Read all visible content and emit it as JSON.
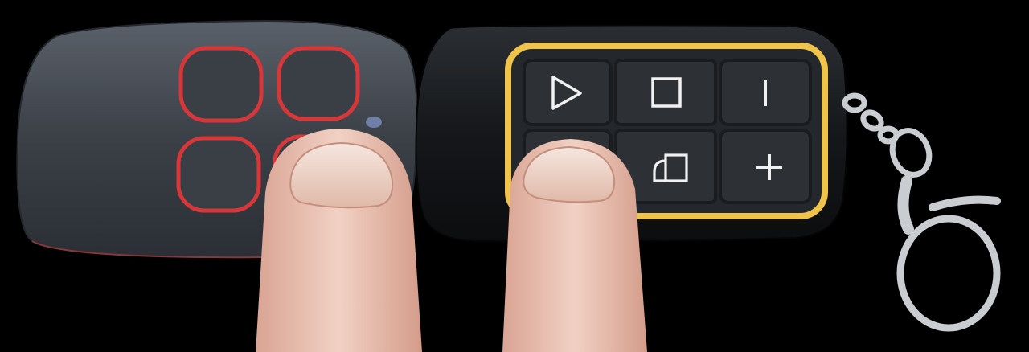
{
  "scene": {
    "background_color": "#000000",
    "left_remote": {
      "body_color": "#3c4148",
      "button_color": "#3a3f46",
      "button_ring_color": "#d8373a",
      "button_count": 4,
      "led_color": "#6f7fa8"
    },
    "right_remote": {
      "body_color": "#16181c",
      "panel_color": "#2a2d32",
      "panel_border_color": "#f0c34a",
      "keys": [
        {
          "icon": "play-triangle-icon"
        },
        {
          "icon": "stop-square-icon"
        },
        {
          "icon": "vertical-bar-icon"
        },
        {
          "icon": "blank-key"
        },
        {
          "icon": "door-lock-icon"
        },
        {
          "icon": "plus-icon"
        }
      ]
    },
    "keyring": {
      "color": "#c9cdd2",
      "icon": "keyring-clip-icon"
    },
    "fingers": {
      "skin_color": "#e9c3b4",
      "count": 2
    }
  }
}
